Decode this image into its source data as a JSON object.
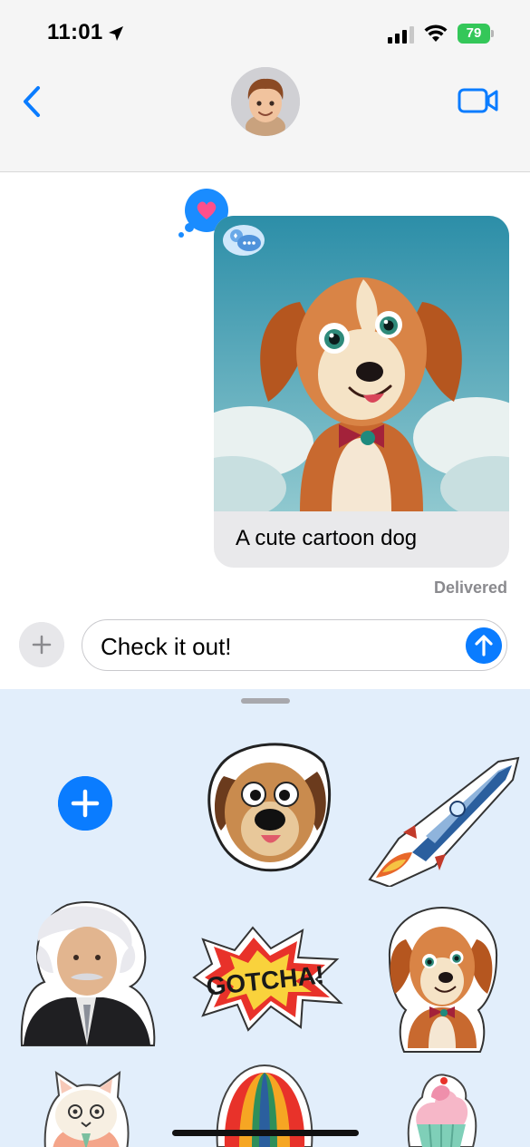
{
  "status_bar": {
    "time": "11:01",
    "battery_percent": "79"
  },
  "conversation": {
    "image_caption": "A cute cartoon dog",
    "delivery_status": "Delivered",
    "tapback_reaction": "heart-icon"
  },
  "compose": {
    "text_value": "Check it out!"
  },
  "stickers": [
    "dog-face-sticker",
    "rocket-sticker",
    "einstein-sticker",
    "gotcha-sticker",
    "cartoon-dog-sticker",
    "cat-sticker",
    "hot-air-balloon-sticker",
    "cupcake-sticker"
  ],
  "colors": {
    "accent": "#0a7cff",
    "battery": "#34c759",
    "drawer_background": "#e2eefb",
    "tapback": "#ff4f8b"
  }
}
